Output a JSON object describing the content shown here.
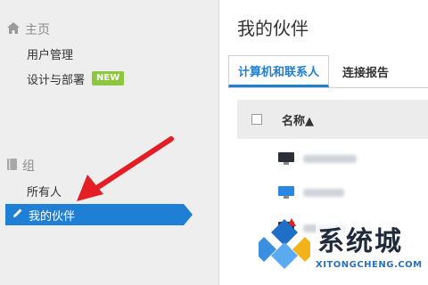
{
  "sidebar": {
    "home_section": {
      "label": "主页",
      "icon": "home-icon"
    },
    "items_top": [
      {
        "label": "用户管理"
      },
      {
        "label": "设计与部署",
        "badge": "NEW"
      }
    ],
    "group_section": {
      "label": "组",
      "icon": "book-icon"
    },
    "items_group": [
      {
        "label": "所有人"
      },
      {
        "label": "我的伙伴",
        "icon": "pencil-icon",
        "active": true
      }
    ]
  },
  "main": {
    "title": "我的伙伴",
    "tabs": [
      {
        "label": "计算机和联系人",
        "active": true
      },
      {
        "label": "连接报告"
      }
    ],
    "table": {
      "column_name": "名称▲",
      "rows": [
        {
          "name": "",
          "icon": "monitor-dark-icon"
        },
        {
          "name": "",
          "icon": "monitor-blue-icon"
        },
        {
          "name": "",
          "icon": "monitor-warning-icon"
        }
      ]
    }
  },
  "watermark": {
    "title": "系统城",
    "url": "XITONGCHENG.COM"
  },
  "colors": {
    "accent": "#1e7fd4",
    "badge": "#8dc63f",
    "annotation_arrow": "#e31e24"
  }
}
